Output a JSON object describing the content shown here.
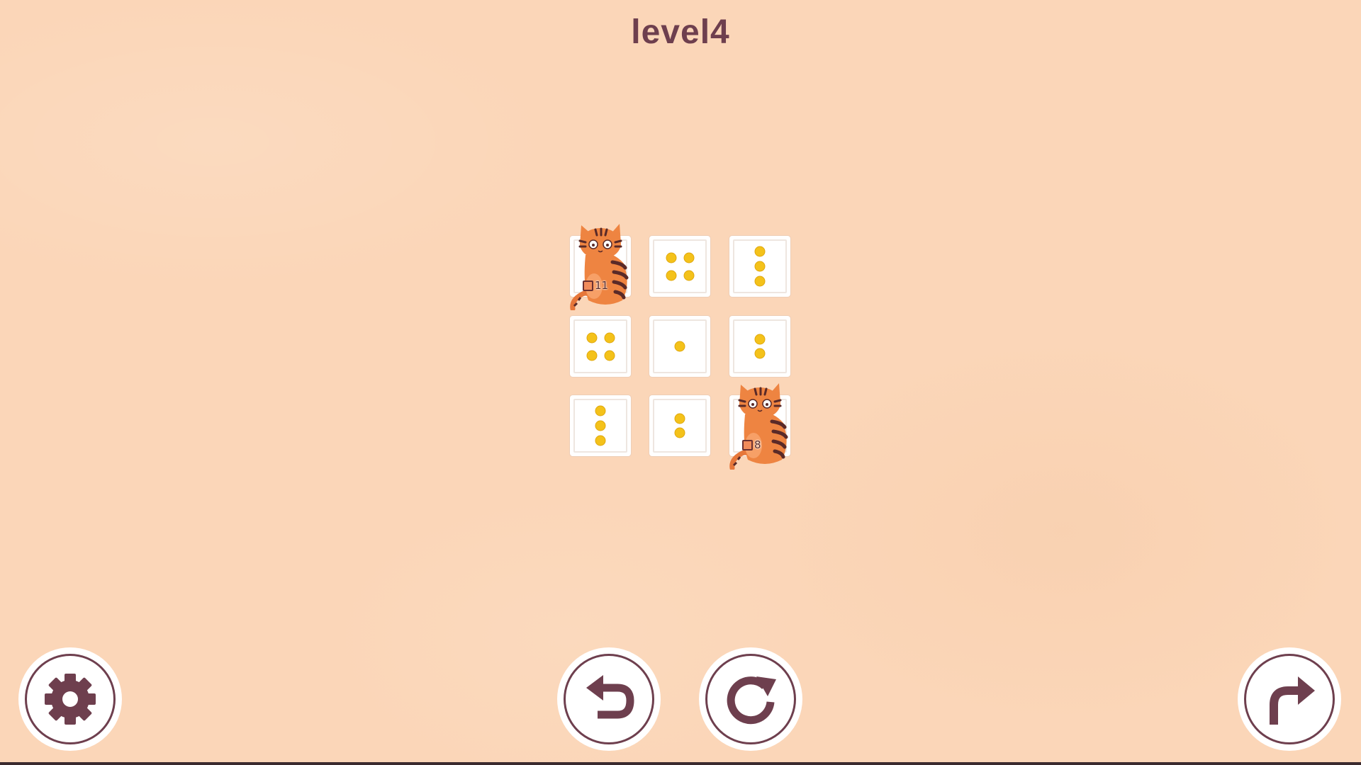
{
  "level_title": "level4",
  "colors": {
    "background": "#fbd6b8",
    "title": "#6e3f4e",
    "pip": "#f4c21a",
    "button_icon": "#6e3f4e"
  },
  "board": {
    "rows": 3,
    "cols": 3,
    "tiles": [
      {
        "row": 0,
        "col": 0,
        "pips": 0,
        "cat": true
      },
      {
        "row": 0,
        "col": 1,
        "pips": 4,
        "cat": false
      },
      {
        "row": 0,
        "col": 2,
        "pips": 3,
        "cat": false
      },
      {
        "row": 1,
        "col": 0,
        "pips": 4,
        "cat": false
      },
      {
        "row": 1,
        "col": 1,
        "pips": 1,
        "cat": false
      },
      {
        "row": 1,
        "col": 2,
        "pips": 2,
        "cat": false
      },
      {
        "row": 2,
        "col": 0,
        "pips": 3,
        "cat": false
      },
      {
        "row": 2,
        "col": 1,
        "pips": 2,
        "cat": false
      },
      {
        "row": 2,
        "col": 2,
        "pips": 0,
        "cat": true
      }
    ]
  },
  "cats": [
    {
      "name": "cat-top-left",
      "counter": "11"
    },
    {
      "name": "cat-bottom-right",
      "counter": "8"
    }
  ],
  "buttons": [
    {
      "name": "settings-button",
      "icon": "gear-icon"
    },
    {
      "name": "undo-button",
      "icon": "undo-arrow-icon"
    },
    {
      "name": "restart-button",
      "icon": "restart-icon"
    },
    {
      "name": "next-button",
      "icon": "redo-arrow-icon"
    }
  ]
}
